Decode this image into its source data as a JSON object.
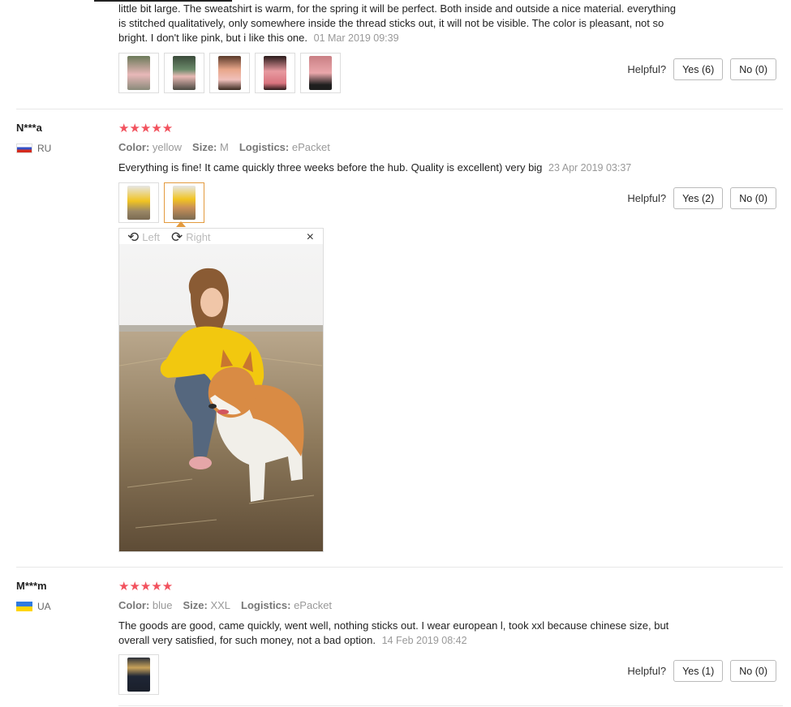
{
  "reviews": [
    {
      "text": "little bit large. The sweatshirt is warm, for the spring it will be perfect. Both inside and outside a nice material. everything is stitched qualitatively, only somewhere inside the thread sticks out, it will not be visible. The color is pleasant, not so bright. I don't like pink, but i like this one.",
      "date": "01 Mar 2019 09:39",
      "helpful_label": "Helpful?",
      "yes_label": "Yes (6)",
      "no_label": "No (0)"
    },
    {
      "user": "N***a",
      "country": "RU",
      "stars": "★★★★★",
      "color_key": "Color:",
      "color_val": "yellow",
      "size_key": "Size:",
      "size_val": "M",
      "logistics_key": "Logistics:",
      "logistics_val": "ePacket",
      "text": "Everything is fine! It came quickly three weeks before the hub. Quality is excellent) very big",
      "date": "23 Apr 2019 03:37",
      "helpful_label": "Helpful?",
      "yes_label": "Yes (2)",
      "no_label": "No (0)"
    },
    {
      "user": "M***m",
      "country": "UA",
      "stars": "★★★★★",
      "color_key": "Color:",
      "color_val": "blue",
      "size_key": "Size:",
      "size_val": "XXL",
      "logistics_key": "Logistics:",
      "logistics_val": "ePacket",
      "text": "The goods are good, came quickly, went well, nothing sticks out. I wear european l, took xxl because chinese size, but overall very satisfied, for such money, not a bad option.",
      "date": "14 Feb 2019 08:42",
      "helpful_label": "Helpful?",
      "yes_label": "Yes (1)",
      "no_label": "No (0)"
    }
  ],
  "viewer": {
    "left_label": "Left",
    "right_label": "Right",
    "close_glyph": "×",
    "rotate_left_glyph": "⟲",
    "rotate_right_glyph": "⟳"
  },
  "colors": {
    "star": "#f2525e",
    "active_thumb": "#e39a3e"
  }
}
